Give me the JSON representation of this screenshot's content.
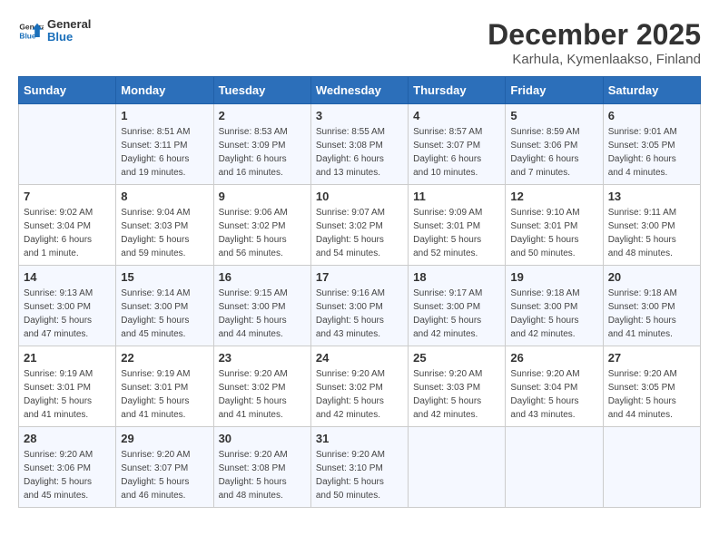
{
  "logo": {
    "line1": "General",
    "line2": "Blue"
  },
  "title": "December 2025",
  "subtitle": "Karhula, Kymenlaakso, Finland",
  "header": {
    "days": [
      "Sunday",
      "Monday",
      "Tuesday",
      "Wednesday",
      "Thursday",
      "Friday",
      "Saturday"
    ]
  },
  "weeks": [
    [
      {
        "day": "",
        "info": ""
      },
      {
        "day": "1",
        "info": "Sunrise: 8:51 AM\nSunset: 3:11 PM\nDaylight: 6 hours\nand 19 minutes."
      },
      {
        "day": "2",
        "info": "Sunrise: 8:53 AM\nSunset: 3:09 PM\nDaylight: 6 hours\nand 16 minutes."
      },
      {
        "day": "3",
        "info": "Sunrise: 8:55 AM\nSunset: 3:08 PM\nDaylight: 6 hours\nand 13 minutes."
      },
      {
        "day": "4",
        "info": "Sunrise: 8:57 AM\nSunset: 3:07 PM\nDaylight: 6 hours\nand 10 minutes."
      },
      {
        "day": "5",
        "info": "Sunrise: 8:59 AM\nSunset: 3:06 PM\nDaylight: 6 hours\nand 7 minutes."
      },
      {
        "day": "6",
        "info": "Sunrise: 9:01 AM\nSunset: 3:05 PM\nDaylight: 6 hours\nand 4 minutes."
      }
    ],
    [
      {
        "day": "7",
        "info": "Sunrise: 9:02 AM\nSunset: 3:04 PM\nDaylight: 6 hours\nand 1 minute."
      },
      {
        "day": "8",
        "info": "Sunrise: 9:04 AM\nSunset: 3:03 PM\nDaylight: 5 hours\nand 59 minutes."
      },
      {
        "day": "9",
        "info": "Sunrise: 9:06 AM\nSunset: 3:02 PM\nDaylight: 5 hours\nand 56 minutes."
      },
      {
        "day": "10",
        "info": "Sunrise: 9:07 AM\nSunset: 3:02 PM\nDaylight: 5 hours\nand 54 minutes."
      },
      {
        "day": "11",
        "info": "Sunrise: 9:09 AM\nSunset: 3:01 PM\nDaylight: 5 hours\nand 52 minutes."
      },
      {
        "day": "12",
        "info": "Sunrise: 9:10 AM\nSunset: 3:01 PM\nDaylight: 5 hours\nand 50 minutes."
      },
      {
        "day": "13",
        "info": "Sunrise: 9:11 AM\nSunset: 3:00 PM\nDaylight: 5 hours\nand 48 minutes."
      }
    ],
    [
      {
        "day": "14",
        "info": "Sunrise: 9:13 AM\nSunset: 3:00 PM\nDaylight: 5 hours\nand 47 minutes."
      },
      {
        "day": "15",
        "info": "Sunrise: 9:14 AM\nSunset: 3:00 PM\nDaylight: 5 hours\nand 45 minutes."
      },
      {
        "day": "16",
        "info": "Sunrise: 9:15 AM\nSunset: 3:00 PM\nDaylight: 5 hours\nand 44 minutes."
      },
      {
        "day": "17",
        "info": "Sunrise: 9:16 AM\nSunset: 3:00 PM\nDaylight: 5 hours\nand 43 minutes."
      },
      {
        "day": "18",
        "info": "Sunrise: 9:17 AM\nSunset: 3:00 PM\nDaylight: 5 hours\nand 42 minutes."
      },
      {
        "day": "19",
        "info": "Sunrise: 9:18 AM\nSunset: 3:00 PM\nDaylight: 5 hours\nand 42 minutes."
      },
      {
        "day": "20",
        "info": "Sunrise: 9:18 AM\nSunset: 3:00 PM\nDaylight: 5 hours\nand 41 minutes."
      }
    ],
    [
      {
        "day": "21",
        "info": "Sunrise: 9:19 AM\nSunset: 3:01 PM\nDaylight: 5 hours\nand 41 minutes."
      },
      {
        "day": "22",
        "info": "Sunrise: 9:19 AM\nSunset: 3:01 PM\nDaylight: 5 hours\nand 41 minutes."
      },
      {
        "day": "23",
        "info": "Sunrise: 9:20 AM\nSunset: 3:02 PM\nDaylight: 5 hours\nand 41 minutes."
      },
      {
        "day": "24",
        "info": "Sunrise: 9:20 AM\nSunset: 3:02 PM\nDaylight: 5 hours\nand 42 minutes."
      },
      {
        "day": "25",
        "info": "Sunrise: 9:20 AM\nSunset: 3:03 PM\nDaylight: 5 hours\nand 42 minutes."
      },
      {
        "day": "26",
        "info": "Sunrise: 9:20 AM\nSunset: 3:04 PM\nDaylight: 5 hours\nand 43 minutes."
      },
      {
        "day": "27",
        "info": "Sunrise: 9:20 AM\nSunset: 3:05 PM\nDaylight: 5 hours\nand 44 minutes."
      }
    ],
    [
      {
        "day": "28",
        "info": "Sunrise: 9:20 AM\nSunset: 3:06 PM\nDaylight: 5 hours\nand 45 minutes."
      },
      {
        "day": "29",
        "info": "Sunrise: 9:20 AM\nSunset: 3:07 PM\nDaylight: 5 hours\nand 46 minutes."
      },
      {
        "day": "30",
        "info": "Sunrise: 9:20 AM\nSunset: 3:08 PM\nDaylight: 5 hours\nand 48 minutes."
      },
      {
        "day": "31",
        "info": "Sunrise: 9:20 AM\nSunset: 3:10 PM\nDaylight: 5 hours\nand 50 minutes."
      },
      {
        "day": "",
        "info": ""
      },
      {
        "day": "",
        "info": ""
      },
      {
        "day": "",
        "info": ""
      }
    ]
  ]
}
